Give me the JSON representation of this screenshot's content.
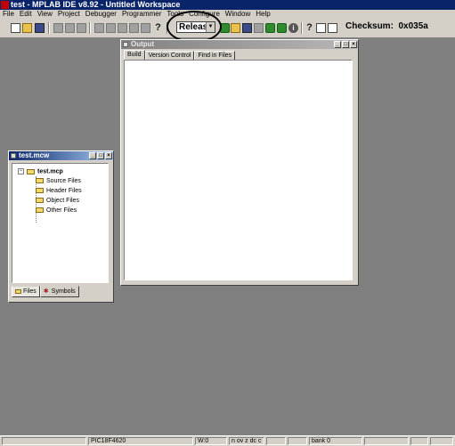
{
  "window": {
    "title": "test - MPLAB IDE v8.92 - Untitled Workspace"
  },
  "menu": [
    "File",
    "Edit",
    "View",
    "Project",
    "Debugger",
    "Programmer",
    "Tools",
    "Configure",
    "Window",
    "Help"
  ],
  "toolbar": {
    "build_config": "Release",
    "checksum_label": "Checksum:",
    "checksum_value": "0x035a",
    "icons": [
      "new-file-icon",
      "open-folder-icon",
      "save-icon",
      "cut-icon",
      "copy-icon",
      "paste-icon",
      "print-icon",
      "help-icon",
      "open-project-icon",
      "save-workspace-icon",
      "workspace-icon",
      "build-icon",
      "info-icon"
    ]
  },
  "output_window": {
    "title": "Output",
    "tabs": [
      "Build",
      "Version Control",
      "Find in Files"
    ],
    "active_tab": "Build"
  },
  "project_window": {
    "title": "test.mcw",
    "tree": {
      "root": "test.mcp",
      "children": [
        "Source Files",
        "Header Files",
        "Object Files",
        "Other Files"
      ]
    },
    "tabs": [
      "Files",
      "Symbols"
    ],
    "active_tab": "Files"
  },
  "statusbar": {
    "device": "PIC18F4620",
    "w_register": "W:0",
    "flags": "n ov z dc c",
    "bank": "bank 0"
  }
}
